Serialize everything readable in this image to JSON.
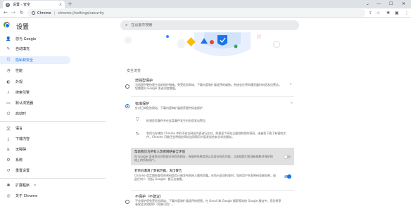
{
  "tab": {
    "title": "设置 - 安全",
    "close": "×",
    "new_tab": "+"
  },
  "window_controls": {
    "dropdown": "⌄",
    "minimize": "—",
    "maximize": "☐",
    "close": "✕"
  },
  "toolbar": {
    "back": "←",
    "forward": "→",
    "reload": "↻",
    "host": "Chrome",
    "url": "chrome://settings/security",
    "share_icon": "⇪",
    "star_icon": "☆",
    "extensions_icon": "✱",
    "profile_icon": "▣",
    "menu_icon": "⋮"
  },
  "header": {
    "title": "设置",
    "search_placeholder": "在设置中搜索"
  },
  "sidebar": {
    "items": [
      {
        "icon": "👤",
        "label": "您与 Google"
      },
      {
        "icon": "✎",
        "label": "自动填充"
      },
      {
        "icon": "⛉",
        "label": "隐私和安全"
      },
      {
        "icon": "◔",
        "label": "性能"
      },
      {
        "icon": "◐",
        "label": "外观"
      },
      {
        "icon": "⌕",
        "label": "搜索引擎"
      },
      {
        "icon": "▭",
        "label": "默认浏览器"
      },
      {
        "icon": "⏻",
        "label": "启动时"
      },
      {
        "icon": "文",
        "label": "语言"
      },
      {
        "icon": "⤓",
        "label": "下载内容"
      },
      {
        "icon": "♿",
        "label": "无障碍"
      },
      {
        "icon": "⚙",
        "label": "系统"
      },
      {
        "icon": "↺",
        "label": "重置设置"
      },
      {
        "icon": "✱",
        "label": "扩展程序",
        "external": "↗"
      },
      {
        "icon": "◎",
        "label": "关于 Chrome"
      }
    ]
  },
  "content": {
    "section_title": "安全浏览",
    "enhanced": {
      "title": "增强型保护",
      "desc": "为您提供更快速主动的保护措施，免受危险网站、下载内容和扩展程序的威胁。系统会在密码遭泄露时向您发出警告。您需要向 Google 发送浏览数据。"
    },
    "standard": {
      "title": "标准保护",
      "desc": "针对已知危险网站、下载内容和扩展程序提供标准保护",
      "sub1": "检测危险事件并在此类事件发生时向您发出警告",
      "sub2": "利用与存储在 Chrome 中的不安全网站列表进行比对。如果某个网站企图窃取您的密码，或者您下载了有害的文件，Chrome 可能还会将相应网址连同网页内容发送给安全浏览服务。",
      "help_title": "帮助我们为所有人改善网络安全环境",
      "help_desc": "向 Google 发送您访问的部分网页的网址、有限的系统信息以及部分网页内容，以协助我们发现新威胁并保护网络上的所有用户。",
      "pwd_title": "若密码遭遇了数据泄露，发出警告",
      "pwd_desc": "Chrome 会定期检查您的密码是否已被发布到网上遭到泄露。在执行此项检查时，您的用户名和密码会被加密，因此任何人（包括 Google）都无法查看。"
    },
    "noprotect": {
      "title": "不保护（不建议）",
      "desc": "不会保护您免受危险网站、下载内容和扩展程序的侵害。在 Gmail 和 Google 搜索等其他 Google 服务中，您仍将享有安全浏览保护（如果可用）。"
    },
    "chevron_up": "⌃",
    "chevron_right": "›",
    "sub1_icon": "⛉",
    "sub2_icon": "↻"
  }
}
